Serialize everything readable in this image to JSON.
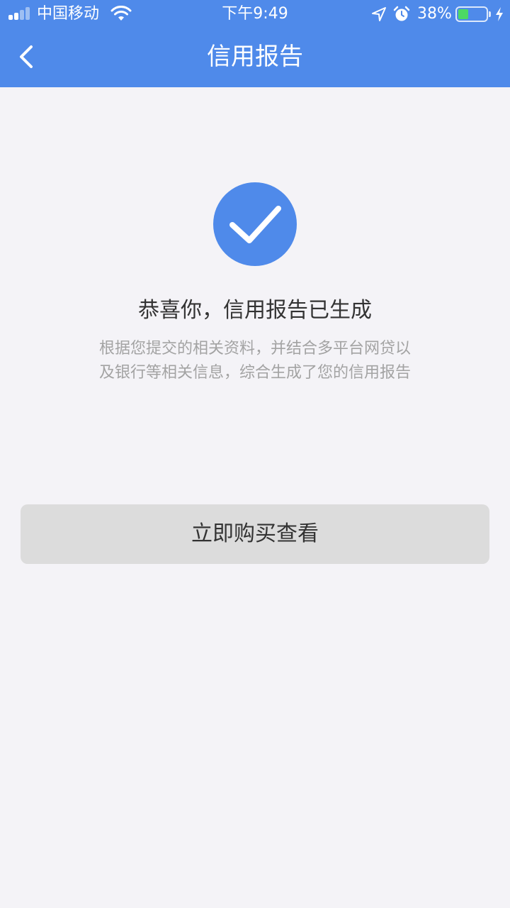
{
  "status_bar": {
    "carrier": "中国移动",
    "time": "下午9:49",
    "battery_percent": "38%",
    "battery_level": 0.38,
    "icons": [
      "signal-icon",
      "wifi-icon",
      "location-icon",
      "alarm-icon",
      "battery-icon",
      "charging-icon"
    ]
  },
  "nav": {
    "title": "信用报告",
    "back_icon": "chevron-left-icon"
  },
  "result": {
    "icon": "checkmark-icon",
    "title": "恭喜你，信用报告已生成",
    "description_line1": "根据您提交的相关资料，并结合多平台网贷以",
    "description_line2": "及银行等相关信息，综合生成了您的信用报告"
  },
  "actions": {
    "buy_label": "立即购买查看"
  },
  "colors": {
    "primary": "#4f8aea",
    "background": "#f4f3f7",
    "button_bg": "#dcdcdc",
    "battery_green": "#4cd964"
  }
}
